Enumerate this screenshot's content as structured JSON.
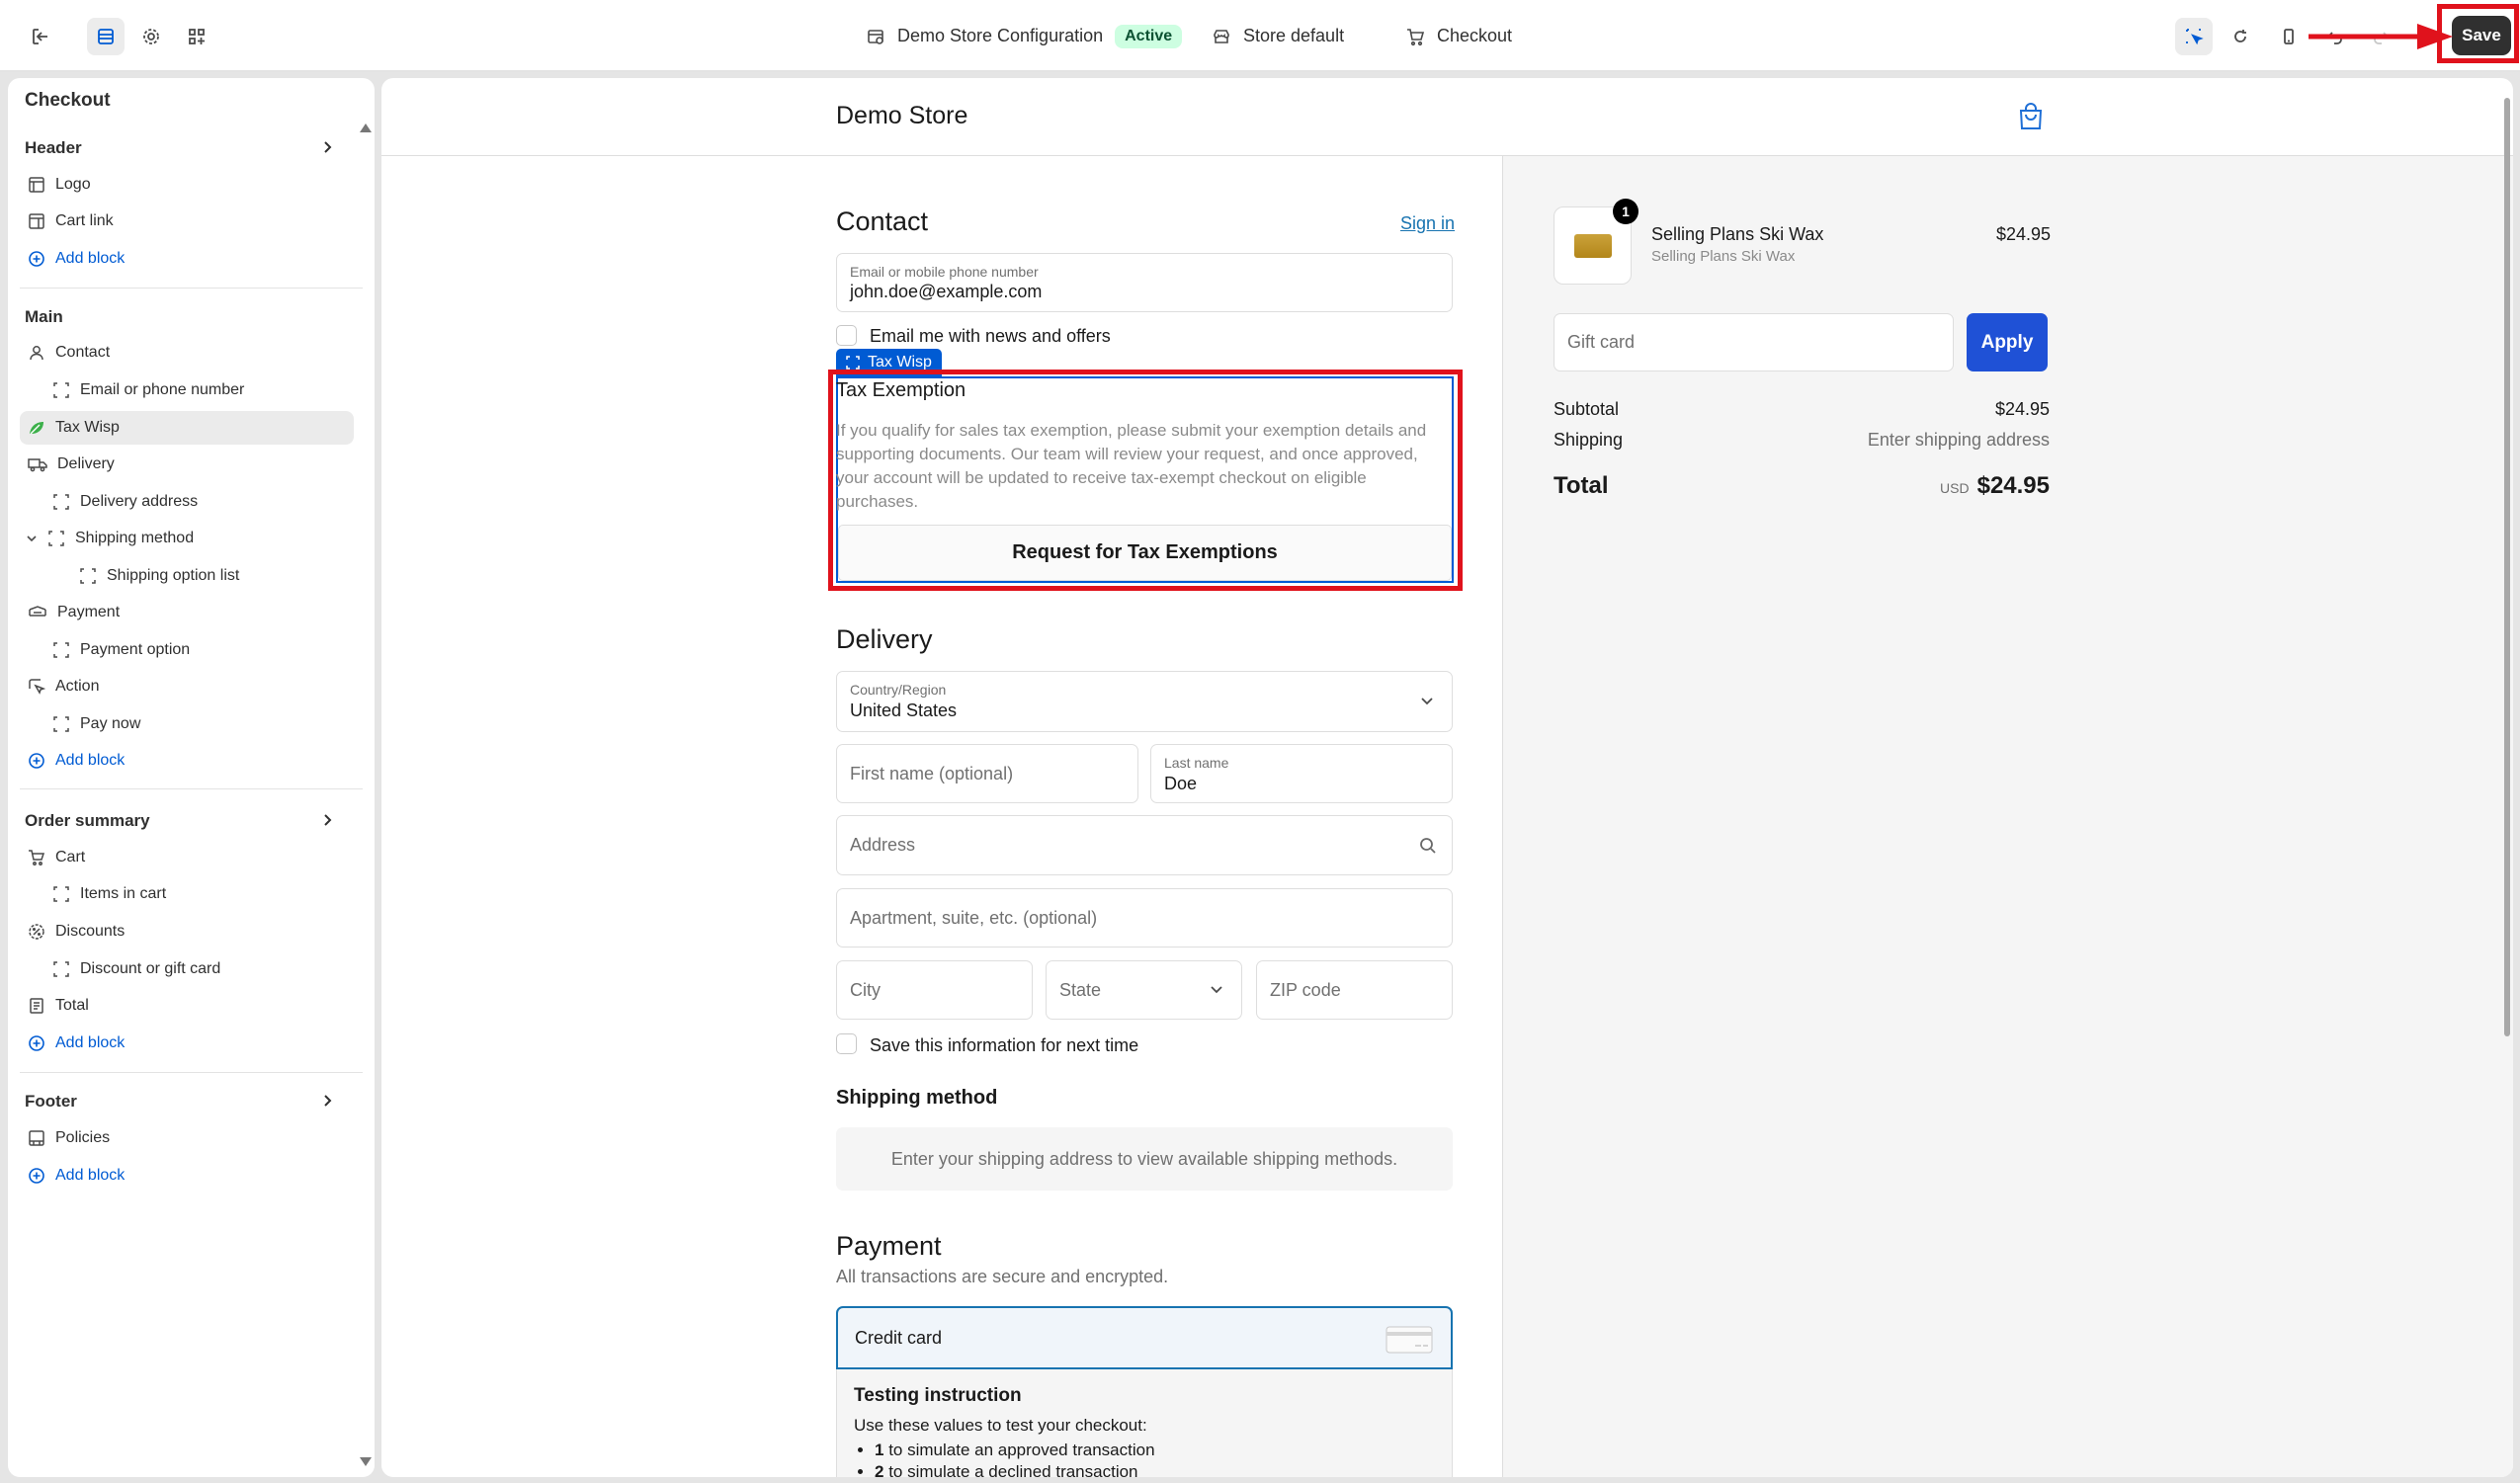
{
  "topbar": {
    "config_name": "Demo Store Configuration",
    "status": "Active",
    "store_default": "Store default",
    "checkout": "Checkout",
    "save_label": "Save"
  },
  "sidebar": {
    "title": "Checkout",
    "header": {
      "label": "Header",
      "items": [
        "Logo",
        "Cart link"
      ],
      "add": "Add block"
    },
    "main": {
      "label": "Main",
      "contact": "Contact",
      "email_or_phone": "Email or phone number",
      "tax_wisp": "Tax Wisp",
      "delivery": "Delivery",
      "delivery_address": "Delivery address",
      "shipping_method": "Shipping method",
      "shipping_option_list": "Shipping option list",
      "payment": "Payment",
      "payment_option": "Payment option",
      "action": "Action",
      "pay_now": "Pay now",
      "add": "Add block"
    },
    "order_summary": {
      "label": "Order summary",
      "cart": "Cart",
      "items_in_cart": "Items in cart",
      "discounts": "Discounts",
      "discount_or_gift": "Discount or gift card",
      "total": "Total",
      "add": "Add block"
    },
    "footer": {
      "label": "Footer",
      "policies": "Policies",
      "add": "Add block"
    }
  },
  "checkout": {
    "store_name": "Demo Store",
    "contact": {
      "heading": "Contact",
      "sign_in": "Sign in",
      "email_label": "Email or mobile phone number",
      "email_value": "john.doe@example.com",
      "news_label": "Email me with news and offers"
    },
    "tax": {
      "tag": "Tax Wisp",
      "title": "Tax Exemption",
      "description": "If you qualify for sales tax exemption, please submit your exemption details and supporting documents. Our team will review your request, and once approved, your account will be updated to receive tax-exempt checkout on eligible purchases.",
      "button": "Request for Tax Exemptions"
    },
    "delivery": {
      "heading": "Delivery",
      "country_label": "Country/Region",
      "country_value": "United States",
      "first_name_ph": "First name (optional)",
      "last_name_label": "Last name",
      "last_name_value": "Doe",
      "address_ph": "Address",
      "apartment_ph": "Apartment, suite, etc. (optional)",
      "city_ph": "City",
      "state_ph": "State",
      "zip_ph": "ZIP code",
      "save_info": "Save this information for next time"
    },
    "shipping": {
      "heading": "Shipping method",
      "message": "Enter your shipping address to view available shipping methods."
    },
    "payment": {
      "heading": "Payment",
      "subtext": "All transactions are secure and encrypted.",
      "credit_card": "Credit card",
      "testing_title": "Testing instruction",
      "testing_intro": "Use these values to test your checkout:",
      "testing_item_1_num": "1",
      "testing_item_1_text": " to simulate an approved transaction",
      "testing_item_2_num": "2",
      "testing_item_2_text": " to simulate a declined transaction"
    }
  },
  "summary": {
    "product_name": "Selling Plans Ski Wax",
    "product_variant": "Selling Plans Ski Wax",
    "product_price": "$24.95",
    "quantity": "1",
    "gift_card_ph": "Gift card",
    "apply": "Apply",
    "subtotal_label": "Subtotal",
    "subtotal_value": "$24.95",
    "shipping_label": "Shipping",
    "shipping_value": "Enter shipping address",
    "total_label": "Total",
    "currency": "USD",
    "total_value": "$24.95"
  },
  "colors": {
    "accent": "#005bd3",
    "annotation": "#e0121c",
    "apply": "#1f51d6"
  }
}
